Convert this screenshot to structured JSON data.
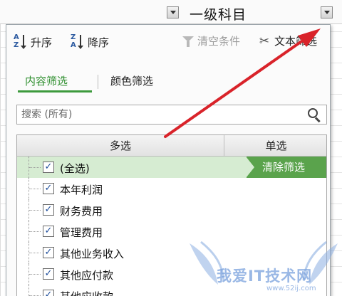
{
  "header": {
    "column_title": "一级科目"
  },
  "toolbar": {
    "sort_asc_label": "升序",
    "sort_desc_label": "降序",
    "clear_label": "清空条件",
    "text_filter_label": "文本筛选"
  },
  "tabs": [
    {
      "label": "内容筛选",
      "active": true
    },
    {
      "label": "颜色筛选",
      "active": false
    }
  ],
  "search": {
    "placeholder": "搜索 (所有)"
  },
  "list": {
    "header_multi": "多选",
    "header_single": "单选",
    "clear_filter_label": "清除筛选",
    "items": [
      {
        "label": "(全选)",
        "checked": true
      },
      {
        "label": "本年利润",
        "checked": true
      },
      {
        "label": "财务费用",
        "checked": true
      },
      {
        "label": "管理费用",
        "checked": true
      },
      {
        "label": "其他业务收入",
        "checked": true
      },
      {
        "label": "其他应付款",
        "checked": true
      },
      {
        "label": "其他应收款",
        "checked": true
      }
    ]
  },
  "watermark": {
    "text": "我爱IT技术网",
    "sub": "www.52ij.com"
  },
  "colors": {
    "accent_green": "#5aa34c",
    "highlight_row": "#d6ecd2",
    "tab_active": "#2f8f2f",
    "annotation_red": "#d9232a"
  },
  "icons": {
    "sort_asc": "sort-ascending-icon",
    "sort_desc": "sort-descending-icon",
    "clear": "funnel-clear-icon",
    "text_filter": "tools-icon",
    "search": "search-icon",
    "dropdown": "chevron-down-icon"
  }
}
